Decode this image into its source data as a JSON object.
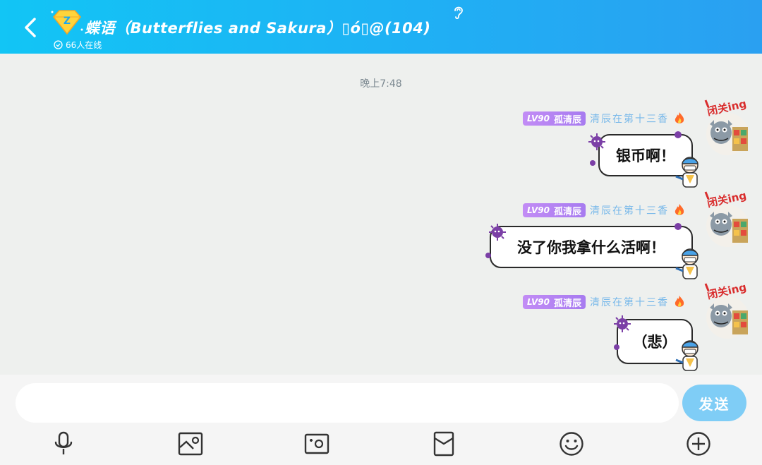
{
  "header": {
    "title": "蝶语（Butterflies and Sakura）▯ó▯@(104)",
    "online": "66人在线"
  },
  "chat": {
    "time": "晚上7:48",
    "messages": [
      {
        "level": "LV90",
        "title_tag": "孤清辰",
        "nickname": "清辰在第十三香",
        "text": "银币啊！",
        "avatar_tag": "闭关ing"
      },
      {
        "level": "LV90",
        "title_tag": "孤清辰",
        "nickname": "清辰在第十三香",
        "text": "没了你我拿什么活啊！",
        "avatar_tag": "闭关ing"
      },
      {
        "level": "LV90",
        "title_tag": "孤清辰",
        "nickname": "清辰在第十三香",
        "text": "（悲）",
        "avatar_tag": "闭关ing"
      }
    ]
  },
  "input": {
    "value": "",
    "send_label": "发送"
  },
  "toolbar": {
    "icons": [
      "microphone-icon",
      "image-icon",
      "camera-icon",
      "red-packet-icon",
      "emoji-icon",
      "plus-icon"
    ]
  },
  "colors": {
    "header_start": "#12c5f5",
    "header_end": "#2aa0f1",
    "level_badge": "#b685f3",
    "nickname": "#79b9ea",
    "send_button": "#7fcdf6"
  }
}
